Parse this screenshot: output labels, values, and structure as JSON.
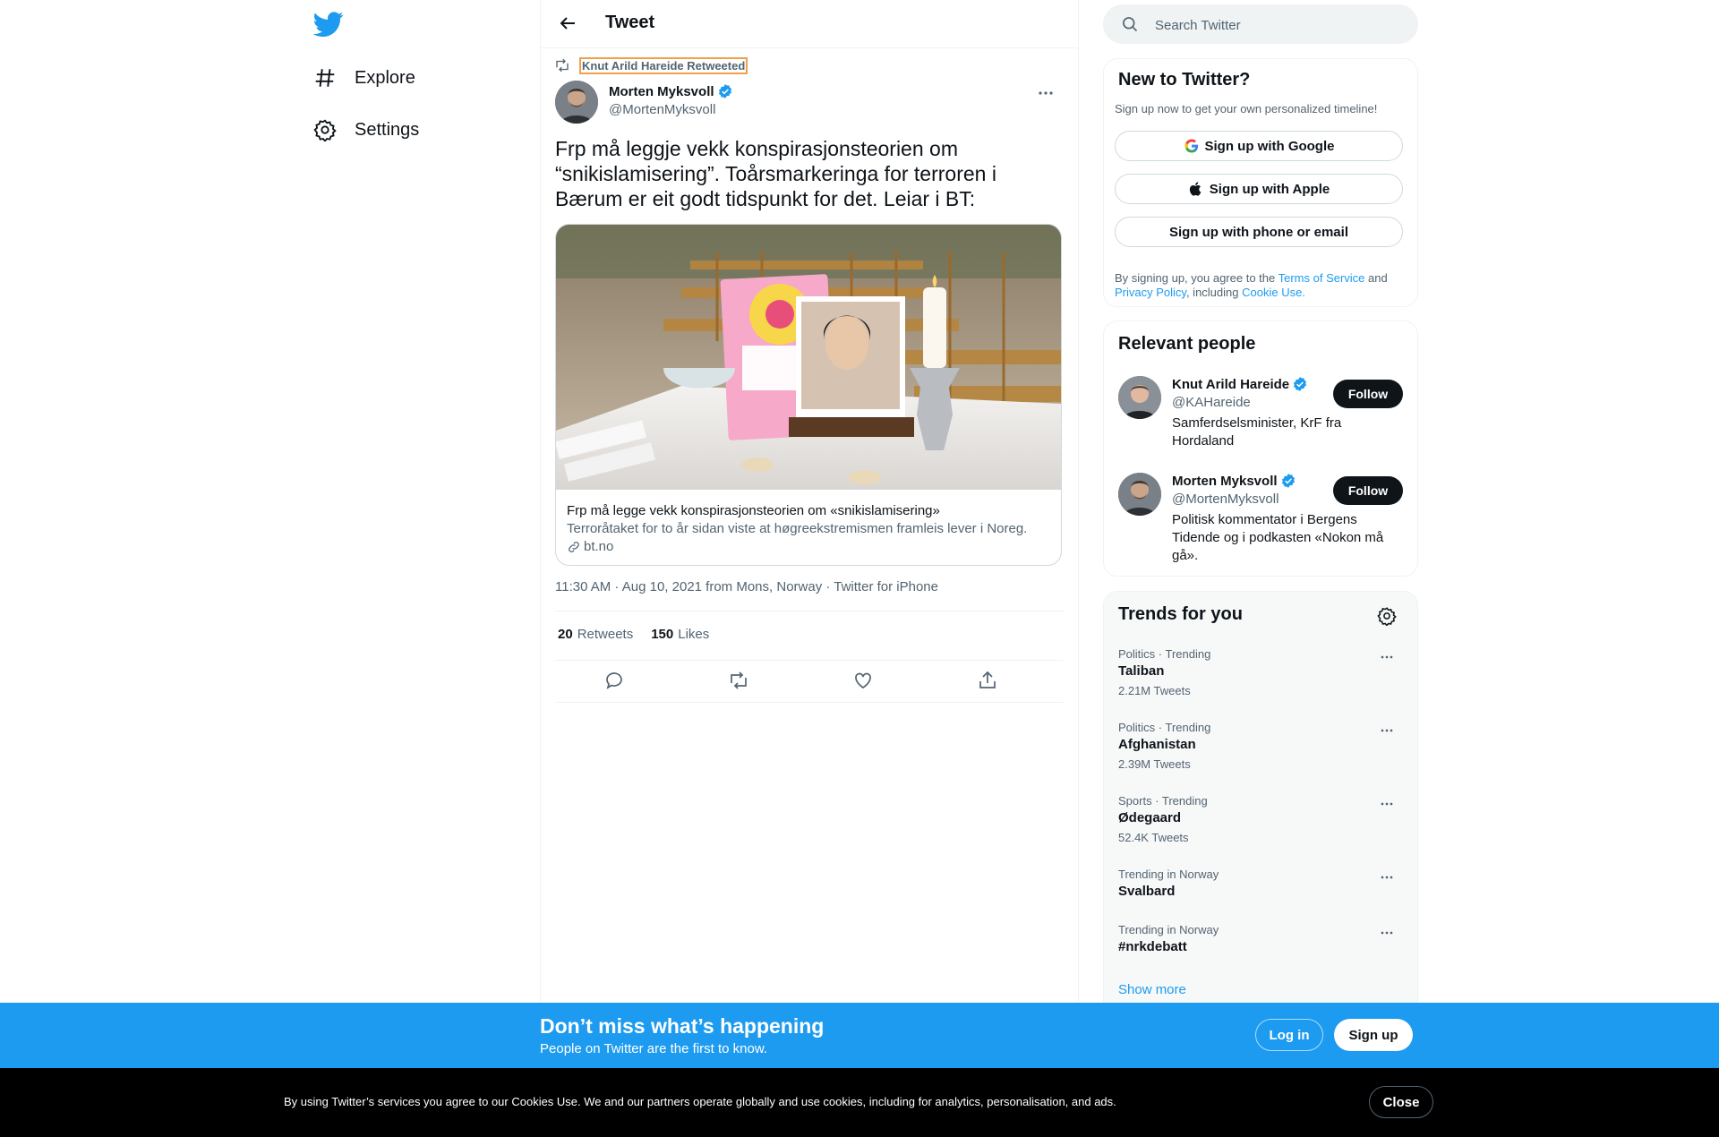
{
  "colors": {
    "brand": "#1d9bf0",
    "text": "#0f1419",
    "muted": "#536471",
    "border": "#eff3f4"
  },
  "nav": {
    "logo_icon": "twitter-bird-icon",
    "items": [
      {
        "label": "Explore",
        "icon": "hashtag-icon"
      },
      {
        "label": "Settings",
        "icon": "gear-icon"
      }
    ]
  },
  "header": {
    "title": "Tweet"
  },
  "tweet": {
    "retweeted_by": "Knut Arild Hareide Retweeted",
    "author_name": "Morten Myksvoll",
    "author_handle": "@MortenMyksvoll",
    "text": "Frp må leggje vekk konspirasjonsteorien om “snikislamisering”. Toårsmarkeringa for terroren i Bærum er eit godt tidspunkt for det. Leiar i BT:",
    "card": {
      "title": "Frp må legge vekk konspirasjonsteorien om «snikislamisering»",
      "description": "Terroråtaket for to år sidan viste at høgreekstremismen framleis lever i Noreg.",
      "domain": "bt.no"
    },
    "meta": "11:30 AM · Aug 10, 2021 from Mons, Norway · Twitter for iPhone",
    "stats": {
      "retweets_count": "20",
      "retweets_label": "Retweets",
      "likes_count": "150",
      "likes_label": "Likes"
    }
  },
  "search": {
    "placeholder": "Search Twitter"
  },
  "new_to_twitter": {
    "title": "New to Twitter?",
    "subtitle": "Sign up now to get your own personalized timeline!",
    "google": "Sign up with Google",
    "apple": "Sign up with Apple",
    "phone": "Sign up with phone or email",
    "legal": {
      "p1": "By signing up, you agree to the ",
      "tos": "Terms of Service",
      "p2": " and ",
      "privacy": "Privacy Policy",
      "p3": ", including ",
      "cookie": "Cookie Use."
    }
  },
  "relevant_people": {
    "title": "Relevant people",
    "people": [
      {
        "name": "Knut Arild Hareide",
        "handle": "@KAHareide",
        "bio": "Samferdselsminister, KrF fra Hordaland",
        "follow": "Follow"
      },
      {
        "name": "Morten Myksvoll",
        "handle": "@MortenMyksvoll",
        "bio": "Politisk kommentator i Bergens Tidende og i podkasten «Nokon må gå».",
        "follow": "Follow"
      }
    ]
  },
  "trends": {
    "title": "Trends for you",
    "items": [
      {
        "category": "Politics · Trending",
        "name": "Taliban",
        "count": "2.21M Tweets"
      },
      {
        "category": "Politics · Trending",
        "name": "Afghanistan",
        "count": "2.39M Tweets"
      },
      {
        "category": "Sports · Trending",
        "name": "Ødegaard",
        "count": "52.4K Tweets"
      },
      {
        "category": "Trending in Norway",
        "name": "Svalbard",
        "count": ""
      },
      {
        "category": "Trending in Norway",
        "name": "#nrkdebatt",
        "count": ""
      }
    ],
    "show_more": "Show more"
  },
  "banner": {
    "title": "Don’t miss what’s happening",
    "subtitle": "People on Twitter are the first to know.",
    "login": "Log in",
    "signup": "Sign up"
  },
  "cookie": {
    "text": "By using Twitter’s services you agree to our Cookies Use. We and our partners operate globally and use cookies, including for analytics, personalisation, and ads.",
    "close": "Close"
  }
}
